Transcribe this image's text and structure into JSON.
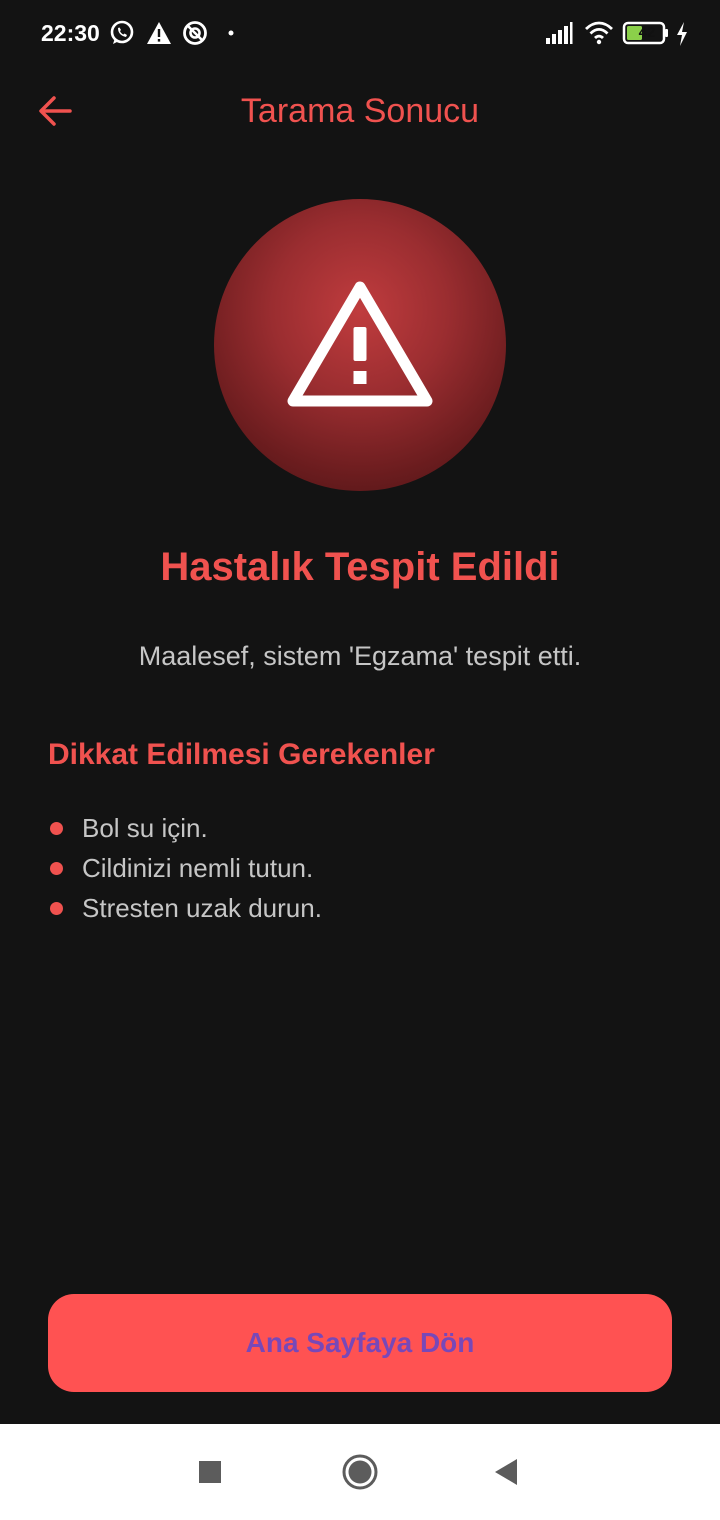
{
  "status_bar": {
    "time": "22:30",
    "battery": "42",
    "icons": [
      "whatsapp-icon",
      "warning-icon",
      "vpn-icon",
      "dot-icon",
      "signal-icon",
      "wifi-icon",
      "battery-icon",
      "charging-icon"
    ]
  },
  "app_bar": {
    "title": "Tarama Sonucu",
    "back_icon": "arrow-left-icon"
  },
  "result": {
    "icon": "warning-triangle-icon",
    "headline": "Hastalık Tespit Edildi",
    "message": "Maalesef, sistem 'Egzama' tespit etti."
  },
  "tips": {
    "title": "Dikkat Edilmesi Gerekenler",
    "items": [
      "Bol su için.",
      "Cildinizi nemli tutun.",
      "Stresten uzak durun."
    ]
  },
  "primary_button": {
    "label": "Ana Sayfaya Dön"
  },
  "nav_bar": {
    "icons": [
      "recents-square-icon",
      "home-circle-icon",
      "back-triangle-icon"
    ]
  },
  "colors": {
    "background": "#131313",
    "accent": "#f0524f",
    "button": "#ff5252",
    "button_text": "#7848b8",
    "body_text": "#c6c6c6"
  }
}
